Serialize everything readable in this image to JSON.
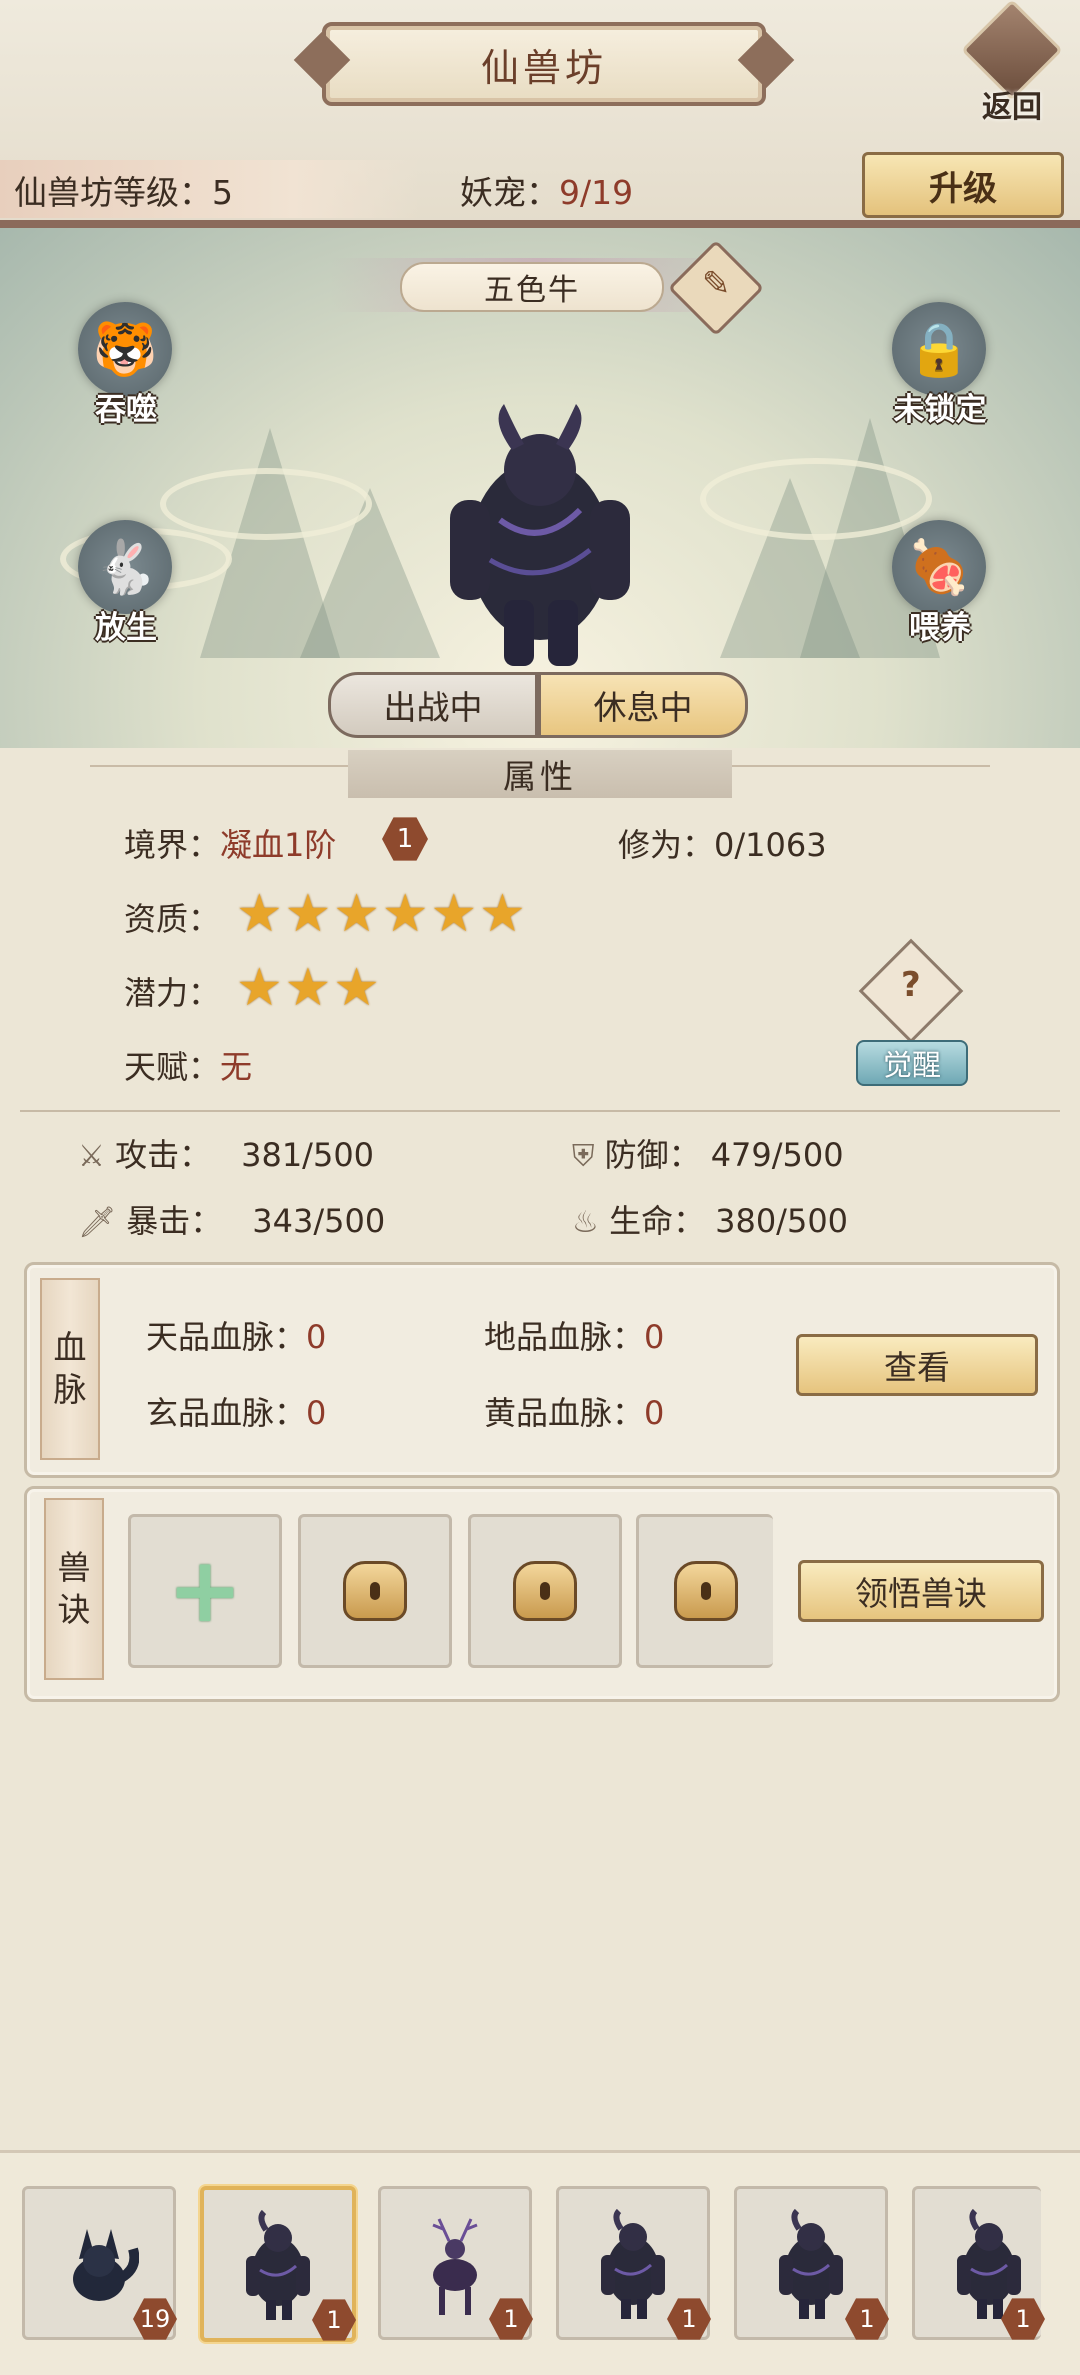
{
  "header": {
    "title": "仙兽坊",
    "back_label": "返回",
    "level_label": "仙兽坊等级：5",
    "pets_label": "妖宠：",
    "pets_value": "9/19",
    "upgrade_label": "升级"
  },
  "pet": {
    "name": "五色牛",
    "actions": {
      "devour": "吞噬",
      "lock": "未锁定",
      "release": "放生",
      "feed": "喂养"
    },
    "status_tabs": [
      "出战中",
      "休息中"
    ],
    "active_tab": "休息中"
  },
  "attributes": {
    "section_title": "属性",
    "realm_label": "境界：",
    "realm_value": "凝血1阶",
    "realm_badge": "1",
    "cultivation_label": "修为：",
    "cultivation_value": "0/1063",
    "aptitude_label": "资质：",
    "aptitude_stars": 6,
    "potential_label": "潜力：",
    "potential_stars": 3,
    "talent_label": "天赋：",
    "talent_value": "无",
    "help_label": "?",
    "awaken_label": "觉醒",
    "stats": {
      "attack_label": "攻击：",
      "attack_value": "381/500",
      "defense_label": "防御：",
      "defense_value": "479/500",
      "crit_label": "暴击：",
      "crit_value": "343/500",
      "life_label": "生命：",
      "life_value": "380/500"
    }
  },
  "bloodline": {
    "tag": [
      "血",
      "脉"
    ],
    "heaven_label": "天品血脉：",
    "heaven_value": "0",
    "earth_label": "地品血脉：",
    "earth_value": "0",
    "mystic_label": "玄品血脉：",
    "mystic_value": "0",
    "yellow_label": "黄品血脉：",
    "yellow_value": "0",
    "view_label": "查看"
  },
  "skills": {
    "tag": [
      "兽",
      "诀"
    ],
    "learn_label": "领悟兽诀"
  },
  "roster": [
    {
      "level": "19",
      "kind": "fox"
    },
    {
      "level": "1",
      "kind": "ox",
      "selected": true
    },
    {
      "level": "1",
      "kind": "deer"
    },
    {
      "level": "1",
      "kind": "ox"
    },
    {
      "level": "1",
      "kind": "ox"
    },
    {
      "level": "1",
      "kind": "ox"
    }
  ],
  "colors": {
    "accent_red": "#8e3b2a",
    "star_gold": "#e8a52a",
    "header_brown": "#8b6a5b"
  }
}
